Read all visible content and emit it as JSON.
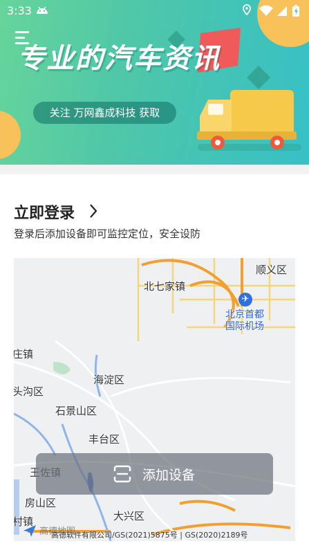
{
  "status_bar": {
    "time": "3:33",
    "icons": [
      "android-icon",
      "location-icon",
      "wifi-icon",
      "signal-icon",
      "battery-charging-icon"
    ]
  },
  "banner": {
    "title": "专业的汽车资讯",
    "pill_text": "关注 万网鑫成科技 获取",
    "colors": {
      "gradient_start": "#67d49a",
      "gradient_end": "#37c0c6",
      "truck": "#f7c94a",
      "accent_red": "#f05a5a"
    }
  },
  "login": {
    "title": "立即登录",
    "subtitle": "登录后添加设备即可监控定位，安全设防"
  },
  "map": {
    "labels": {
      "shunyi": "顺义区",
      "beiqijia": "北七家镇",
      "airport_line1": "北京首都",
      "airport_line2": "国际机场",
      "zhuangzhen": "庄镇",
      "haidian": "海淀区",
      "toutou": "头沟区",
      "shijingshan": "石景山区",
      "fengtai": "丰台区",
      "wangzuo": "王佐镇",
      "fangshan": "房山区",
      "daxing": "大兴区",
      "cunzhen": "村镇"
    },
    "copyright": "高德软件有限公司/GS(2021)5875号 | GS(2020)2189号",
    "logo_text": "高德地图"
  },
  "add_device": {
    "label": "添加设备"
  }
}
